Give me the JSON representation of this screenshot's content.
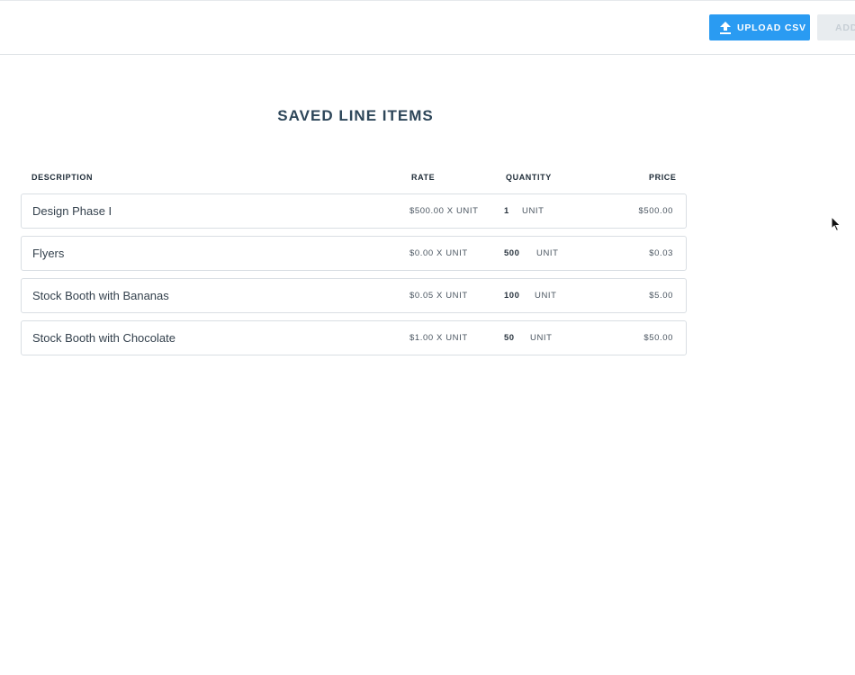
{
  "toolbar": {
    "upload_label": "UPLOAD CSV",
    "add_label": "ADD"
  },
  "page": {
    "title": "SAVED LINE ITEMS"
  },
  "table": {
    "headers": {
      "description": "DESCRIPTION",
      "rate": "RATE",
      "quantity": "QUANTITY",
      "price": "PRICE"
    },
    "rows": [
      {
        "description": "Design Phase I",
        "rate": "$500.00 X UNIT",
        "quantity": "1",
        "unit": "UNIT",
        "price": "$500.00"
      },
      {
        "description": "Flyers",
        "rate": "$0.00 X UNIT",
        "quantity": "500",
        "unit": "UNIT",
        "price": "$0.03"
      },
      {
        "description": "Stock Booth with Bananas",
        "rate": "$0.05 X UNIT",
        "quantity": "100",
        "unit": "UNIT",
        "price": "$5.00"
      },
      {
        "description": "Stock Booth with Chocolate",
        "rate": "$1.00 X UNIT",
        "quantity": "50",
        "unit": "UNIT",
        "price": "$50.00"
      }
    ]
  },
  "colors": {
    "accent": "#2a9bf2",
    "disabled_button": "#e8ecef",
    "title": "#2d4659"
  },
  "icons": {
    "upload": "upload-icon",
    "cursor": "mouse-pointer-icon"
  }
}
